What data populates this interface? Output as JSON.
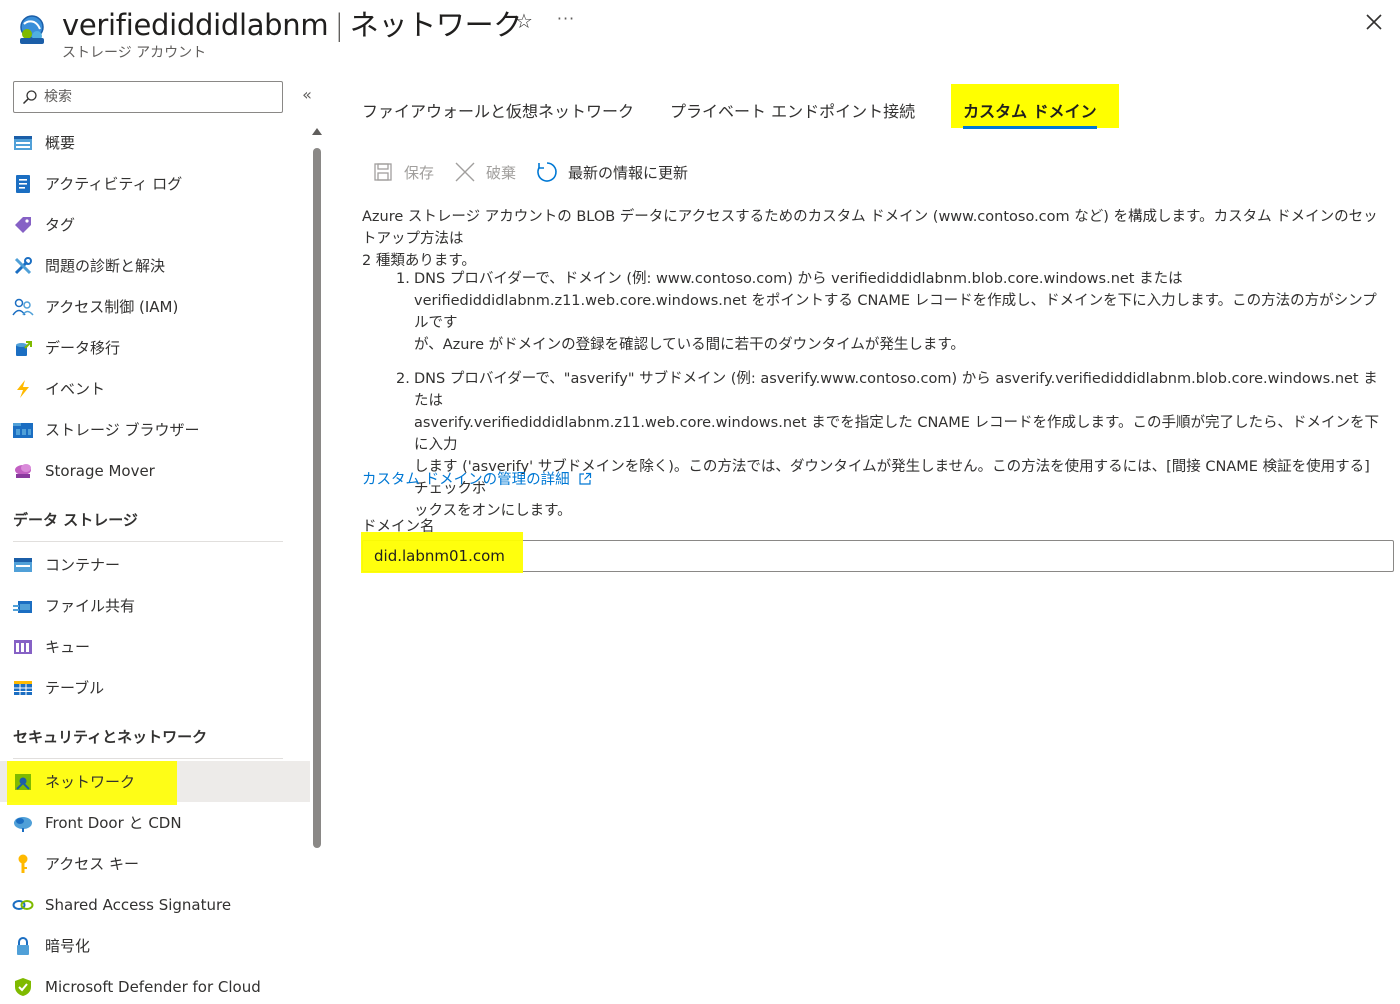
{
  "header": {
    "resource_name": "verifiediddidlabnm",
    "separator": "|",
    "page_name": "ネットワーク",
    "subtitle": "ストレージ アカウント",
    "star_glyph": "☆",
    "more_glyph": "···"
  },
  "sidebar": {
    "search_placeholder": "検索",
    "collapse_glyph": "«",
    "items_top": [
      {
        "label": "概要",
        "icon": "overview-icon"
      },
      {
        "label": "アクティビティ ログ",
        "icon": "activity-log-icon"
      },
      {
        "label": "タグ",
        "icon": "tag-icon"
      },
      {
        "label": "問題の診断と解決",
        "icon": "diagnose-icon"
      },
      {
        "label": "アクセス制御 (IAM)",
        "icon": "iam-icon"
      },
      {
        "label": "データ移行",
        "icon": "data-migration-icon"
      },
      {
        "label": "イベント",
        "icon": "event-icon"
      },
      {
        "label": "ストレージ ブラウザー",
        "icon": "storage-browser-icon"
      },
      {
        "label": "Storage Mover",
        "icon": "storage-mover-icon"
      }
    ],
    "group_data_storage": {
      "title": "データ ストレージ",
      "items": [
        {
          "label": "コンテナー",
          "icon": "container-icon"
        },
        {
          "label": "ファイル共有",
          "icon": "file-share-icon"
        },
        {
          "label": "キュー",
          "icon": "queue-icon"
        },
        {
          "label": "テーブル",
          "icon": "table-icon"
        }
      ]
    },
    "group_security": {
      "title": "セキュリティとネットワーク",
      "items": [
        {
          "label": "ネットワーク",
          "icon": "network-icon",
          "selected": true
        },
        {
          "label": "Front Door と CDN",
          "icon": "front-door-icon"
        },
        {
          "label": "アクセス キー",
          "icon": "access-key-icon"
        },
        {
          "label": "Shared Access Signature",
          "icon": "sas-icon"
        },
        {
          "label": "暗号化",
          "icon": "encryption-icon"
        },
        {
          "label": "Microsoft Defender for Cloud",
          "icon": "defender-icon"
        }
      ]
    }
  },
  "main": {
    "tabs": [
      {
        "label": "ファイアウォールと仮想ネットワーク"
      },
      {
        "label": "プライベート エンドポイント接続"
      },
      {
        "label": "カスタム ドメイン",
        "active": true
      }
    ],
    "toolbar": {
      "save_label": "保存",
      "discard_label": "破棄",
      "refresh_label": "最新の情報に更新"
    },
    "description_line1": "Azure ストレージ アカウントの BLOB データにアクセスするためのカスタム ドメイン (www.contoso.com など) を構成します。カスタム ドメインのセットアップ方法は",
    "description_line2": "2 種類あります。",
    "steps": [
      {
        "num": "1.",
        "lines": [
          "DNS プロバイダーで、ドメイン (例: www.contoso.com) から verifiediddidlabnm.blob.core.windows.net または",
          "verifiediddidlabnm.z11.web.core.windows.net をポイントする CNAME レコードを作成し、ドメインを下に入力します。この方法の方がシンプルです",
          "が、Azure がドメインの登録を確認している間に若干のダウンタイムが発生します。"
        ]
      },
      {
        "num": "2.",
        "lines": [
          "DNS プロバイダーで、\"asverify\" サブドメイン (例: asverify.www.contoso.com) から asverify.verifiediddidlabnm.blob.core.windows.net または",
          "asverify.verifiediddidlabnm.z11.web.core.windows.net までを指定した CNAME レコードを作成します。この手順が完了したら、ドメインを下に入力",
          "します ('asverify' サブドメインを除く)。この方法では、ダウンタイムが発生しません。この方法を使用するには、[間接 CNAME 検証を使用する] チェックボ",
          "ックスをオンにします。"
        ]
      }
    ],
    "learn_more_link": "カスタム ドメインの管理の詳細",
    "domain_field": {
      "label": "ドメイン名",
      "value": "did.labnm01.com"
    }
  },
  "colors": {
    "accent": "#0078d4",
    "highlight": "#ffff00",
    "selected_bg": "#edebe9"
  }
}
